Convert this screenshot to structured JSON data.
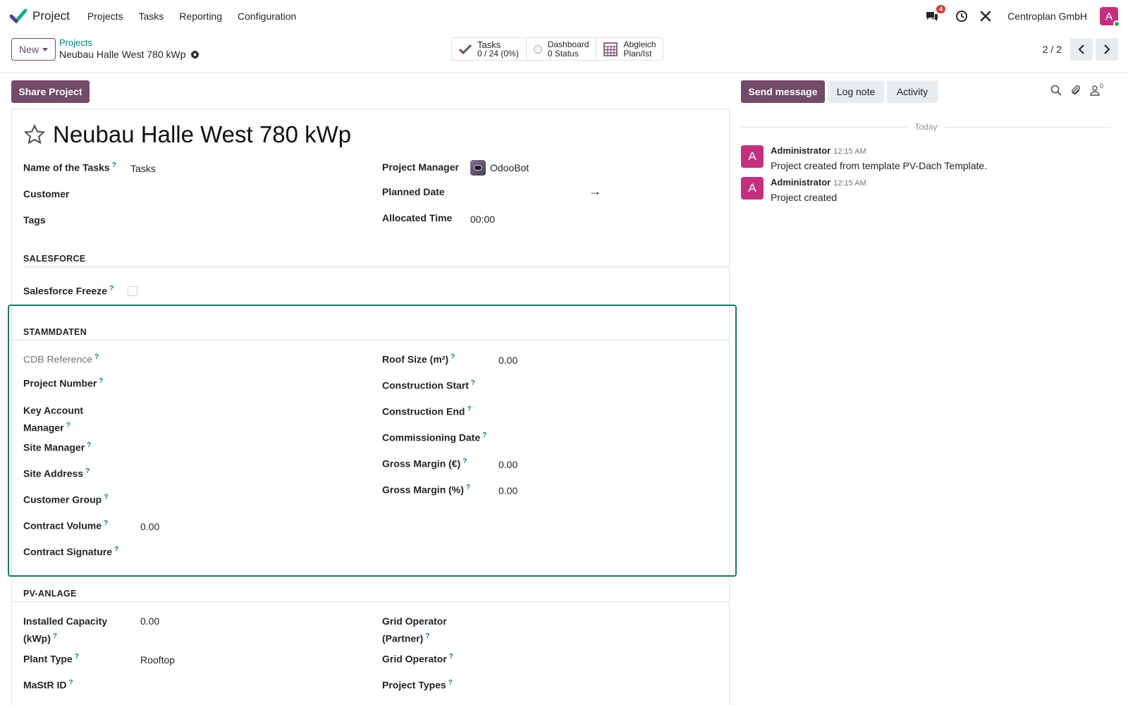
{
  "navbar": {
    "app_name": "Project",
    "menu": [
      "Projects",
      "Tasks",
      "Reporting",
      "Configuration"
    ],
    "chat_badge": "4",
    "company": "Centroplan GmbH",
    "user_initial": "A"
  },
  "control": {
    "new_label": "New",
    "breadcrumb_parent": "Projects",
    "breadcrumb_current": "Neubau Halle West 780 kWp",
    "smart_buttons": [
      {
        "line1": "Tasks",
        "line2": "0 / 24 (0%)"
      },
      {
        "line1": "Dashboard",
        "line2": "0 Status"
      },
      {
        "line1": "Abgleich",
        "line2": "Plan/Ist"
      }
    ],
    "pager": "2 / 2"
  },
  "form": {
    "share_label": "Share Project",
    "title": "Neubau Halle West 780 kWp",
    "fields_top": {
      "name_of_tasks_label": "Name of the Tasks",
      "name_of_tasks_value": "Tasks",
      "customer_label": "Customer",
      "tags_label": "Tags",
      "project_manager_label": "Project Manager",
      "project_manager_value": "OdooBot",
      "planned_date_label": "Planned Date",
      "planned_date_arrow": "→",
      "allocated_time_label": "Allocated Time",
      "allocated_time_value": "00:00"
    },
    "salesforce": {
      "title": "SALESFORCE",
      "freeze_label": "Salesforce Freeze"
    },
    "stammdaten": {
      "title": "STAMMDATEN",
      "cdb_reference": "CDB Reference",
      "project_number": "Project Number",
      "key_account_line1": "Key Account",
      "key_account_line2": "Manager",
      "site_manager": "Site Manager",
      "site_address": "Site Address",
      "customer_group": "Customer Group",
      "contract_volume": "Contract Volume",
      "contract_volume_value": "0.00",
      "contract_signature": "Contract Signature",
      "roof_size": "Roof Size (m²)",
      "roof_size_value": "0.00",
      "construction_start": "Construction Start",
      "construction_end": "Construction End",
      "commissioning_date": "Commissioning Date",
      "gross_margin_eur": "Gross Margin (€)",
      "gross_margin_eur_value": "0.00",
      "gross_margin_pct": "Gross Margin (%)",
      "gross_margin_pct_value": "0.00"
    },
    "pv_anlage": {
      "title": "PV-ANLAGE",
      "installed_capacity_line1": "Installed Capacity",
      "installed_capacity_line2": "(kWp)",
      "installed_capacity_value": "0.00",
      "plant_type": "Plant Type",
      "plant_type_value": "Rooftop",
      "mastr_id": "MaStR ID",
      "grid_operator_partner_line1": "Grid Operator",
      "grid_operator_partner_line2": "(Partner)",
      "grid_operator": "Grid Operator",
      "project_types": "Project Types"
    },
    "help_mark": "?"
  },
  "chatter": {
    "send_message": "Send message",
    "log_note": "Log note",
    "activity": "Activity",
    "followers_count": "0",
    "separator": "Today",
    "messages": [
      {
        "initial": "A",
        "author": "Administrator",
        "time": "12:15 AM",
        "body": "Project created from template PV-Dach Template."
      },
      {
        "initial": "A",
        "author": "Administrator",
        "time": "12:15 AM",
        "body": "Project created"
      }
    ]
  }
}
